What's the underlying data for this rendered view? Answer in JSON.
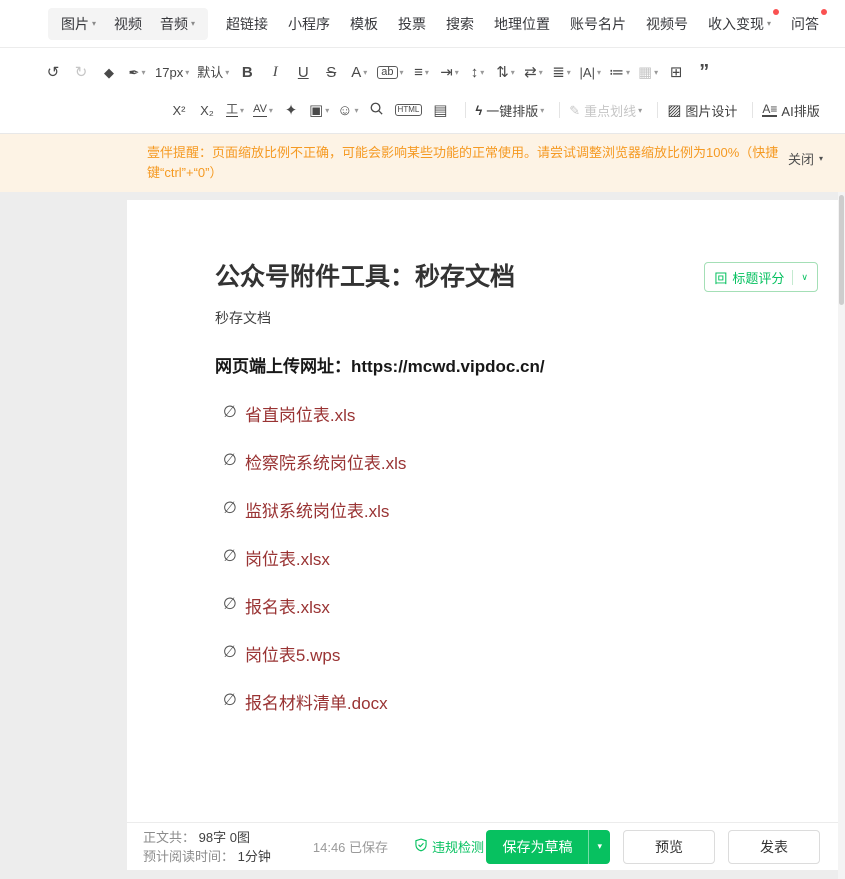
{
  "colors": {
    "green": "#07c160",
    "orange": "#f59a23",
    "link_red": "#993333",
    "badge_red": "#fa5151"
  },
  "icons": {
    "caret": "▾",
    "chevron": "∨",
    "undo": "↺",
    "redo": "↻",
    "format_painter": "◆",
    "clear_format": "✒",
    "bold": "B",
    "italic": "I",
    "underline": "U",
    "strikethrough": "S",
    "font_color": "A",
    "highlight": "ab",
    "align": "≡",
    "indent": "⇥",
    "line_height": "↕",
    "para_spacing": "⇅",
    "letter_spacing": "⇄",
    "list": "≣",
    "text_width": "|A|",
    "ordered_list": "≔",
    "insert_object": "▦",
    "table": "⊞",
    "quote": "”",
    "superscript": "X²",
    "subscript": "X₂",
    "pinyin": "工",
    "text_border": "AV",
    "magic": "✦",
    "image_tool": "▣",
    "emoji": "☺",
    "html": "HTML",
    "material": "▤",
    "lightning": "ϟ",
    "marker": "✎",
    "picture": "▨",
    "ai": "A≡",
    "score": "回",
    "attachment": "∅"
  },
  "menubar": {
    "media": [
      {
        "label": "图片"
      },
      {
        "label": "视频"
      },
      {
        "label": "音频"
      }
    ],
    "items": [
      {
        "label": "超链接"
      },
      {
        "label": "小程序"
      },
      {
        "label": "模板"
      },
      {
        "label": "投票"
      },
      {
        "label": "搜索"
      },
      {
        "label": "地理位置"
      },
      {
        "label": "账号名片"
      },
      {
        "label": "视频号"
      },
      {
        "label": "收入变现"
      },
      {
        "label": "问答"
      }
    ]
  },
  "toolbar": {
    "font_size": "17px",
    "font_family": "默认",
    "one_click": "一键排版",
    "key_line": "重点划线",
    "image_design": "图片设计",
    "ai_layout": "AI排版"
  },
  "warning": {
    "prefix": "壹伴提醒：",
    "text": "页面缩放比例不正确，可能会影响某些功能的正常使用。请尝试调整浏览器缩放比例为100%（快捷键“ctrl”+“0”）",
    "close": "关闭"
  },
  "document": {
    "title": "公众号附件工具：秒存文档",
    "title_score_label": "标题评分",
    "author": "秒存文档",
    "lead": "网页端上传网址：https://mcwd.vipdoc.cn/",
    "attachments": [
      "省直岗位表.xls",
      "检察院系统岗位表.xls",
      "监狱系统岗位表.xls",
      "岗位表.xlsx",
      "报名表.xlsx",
      "岗位表5.wps",
      "报名材料清单.docx"
    ]
  },
  "footer": {
    "count_label": "正文共：",
    "count_value": "98字 0图",
    "read_label": "预计阅读时间：",
    "read_value": "1分钟",
    "saved_status": "14:46 已保存",
    "check_label": "违规检测",
    "save_draft": "保存为草稿",
    "preview": "预览",
    "publish": "发表"
  }
}
